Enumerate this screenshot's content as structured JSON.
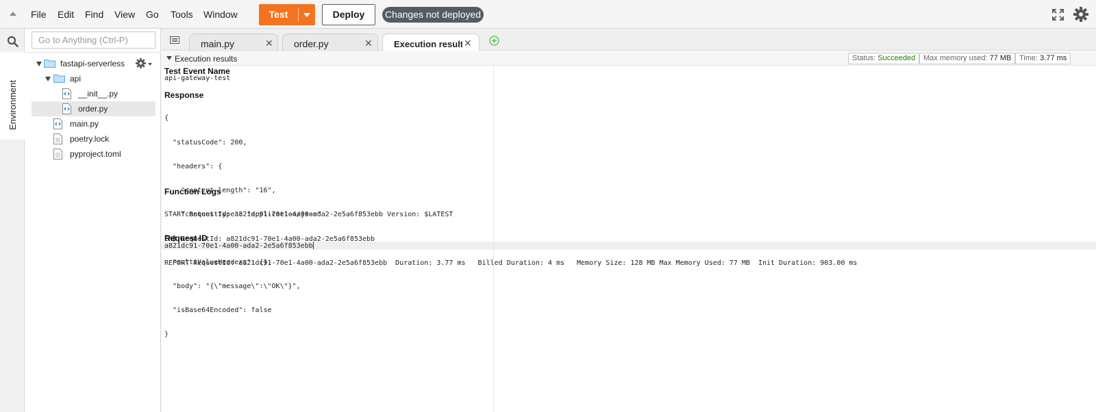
{
  "menubar": {
    "items": [
      "File",
      "Edit",
      "Find",
      "View",
      "Go",
      "Tools",
      "Window"
    ],
    "test_label": "Test",
    "deploy_label": "Deploy",
    "status_badge": "Changes not deployed"
  },
  "sidebar": {
    "search_placeholder": "Go to Anything (Ctrl-P)",
    "env_tab_label": "Environment",
    "tree": {
      "root": "fastapi-serverless",
      "folder": "api",
      "init_file": "__init__.py",
      "order_file": "order.py",
      "main_file": "main.py",
      "poetry_file": "poetry.lock",
      "pyproject_file": "pyproject.toml"
    }
  },
  "tabs": [
    {
      "label": "main.py"
    },
    {
      "label": "order.py"
    },
    {
      "label": "Execution results"
    }
  ],
  "results": {
    "header_title": "Execution results",
    "status_label": "Status:",
    "status_value": "Succeeded",
    "memory_label": "Max memory used:",
    "memory_value": "77 MB",
    "time_label": "Time:",
    "time_value": "3.77 ms",
    "test_event_title": "Test Event Name",
    "test_event_value": "api-gateway-test",
    "response_title": "Response",
    "response_lines": [
      "{",
      "  \"statusCode\": 200,",
      "  \"headers\": {",
      "    \"content-length\": \"16\",",
      "    \"content-type\": \"application/json\"",
      "  },",
      "  \"multiValueHeaders\": {},",
      "  \"body\": \"{\\\"message\\\":\\\"OK\\\"}\",",
      "  \"isBase64Encoded\": false",
      "}"
    ],
    "logs_title": "Function Logs",
    "log_lines": [
      "START RequestId: a821dc91-70e1-4a00-ada2-2e5a6f853ebb Version: $LATEST",
      "END RequestId: a821dc91-70e1-4a00-ada2-2e5a6f853ebb",
      "REPORT RequestId: a821dc91-70e1-4a00-ada2-2e5a6f853ebb  Duration: 3.77 ms   Billed Duration: 4 ms   Memory Size: 128 MB Max Memory Used: 77 MB  Init Duration: 903.00 ms"
    ],
    "request_id_title": "Request ID",
    "request_id_value": "a821dc91-70e1-4a00-ada2-2e5a6f853ebb"
  },
  "colors": {
    "accent": "#f47321",
    "badge": "#545b64",
    "success": "#1d8102",
    "folder": "#7cc4ef",
    "file_icon": "#2d7ac9"
  }
}
